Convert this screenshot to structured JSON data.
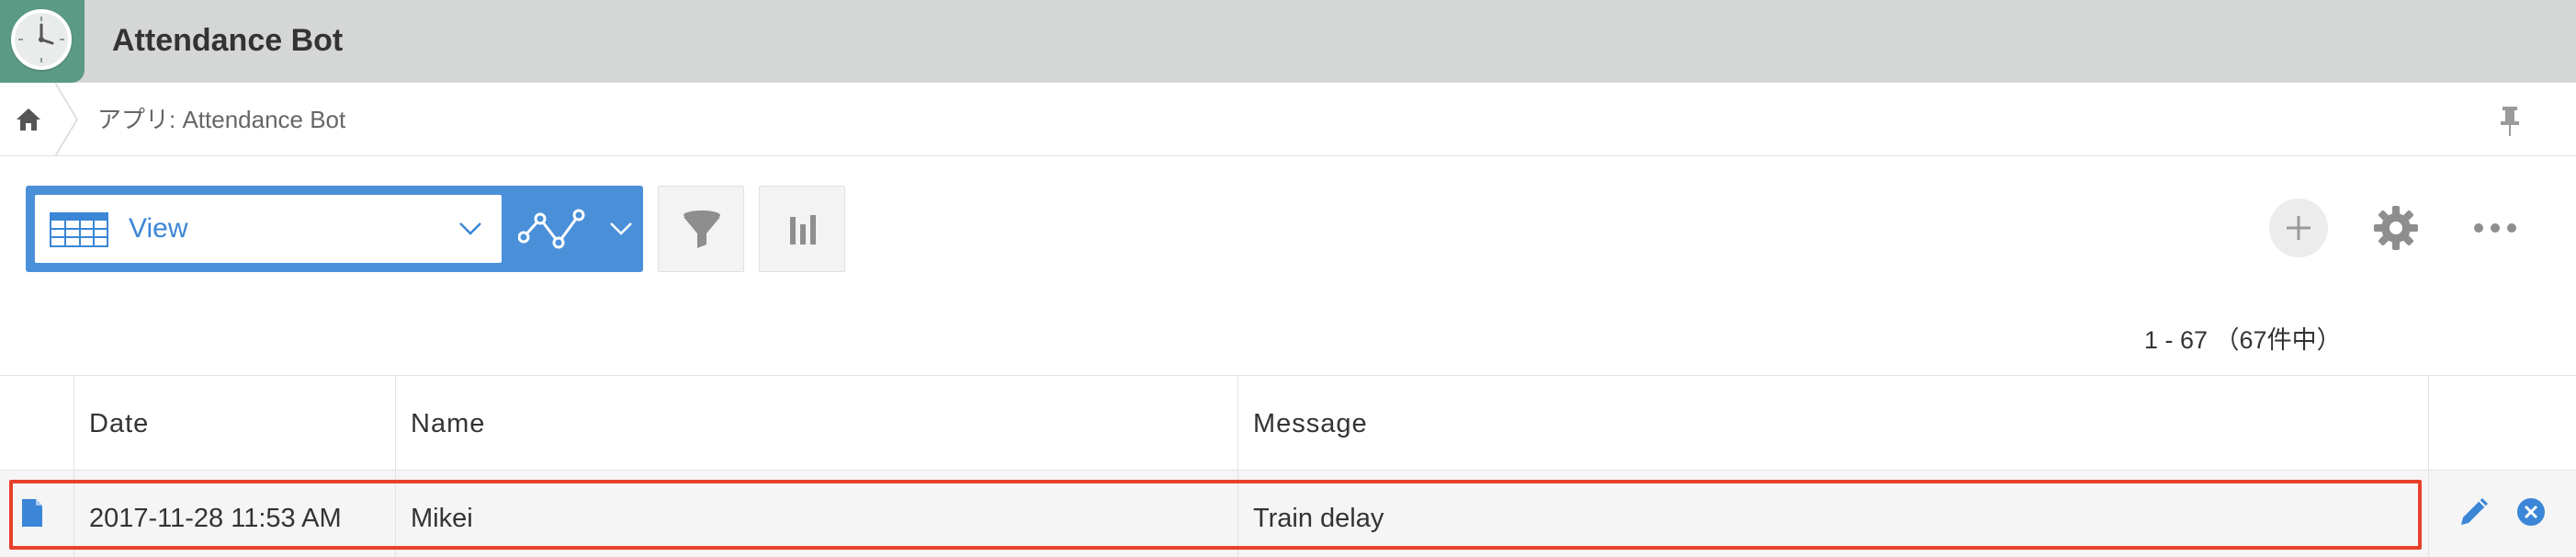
{
  "app": {
    "title": "Attendance Bot",
    "icon": "clock-icon",
    "header_color": "#d5d6d6",
    "icon_color": "#5b9a84"
  },
  "breadcrumb": {
    "text": "アプリ: Attendance Bot"
  },
  "toolbar": {
    "view_label": "View",
    "accent_color": "#4a90d9"
  },
  "pager": {
    "text": "1 - 67 （67件中）"
  },
  "table": {
    "columns": [
      "Date",
      "Name",
      "Message"
    ],
    "rows": [
      {
        "Date": "2017-11-28 11:53 AM",
        "Name": "Mikei",
        "Message": "Train delay"
      }
    ]
  },
  "highlight_color": "#e8412c"
}
